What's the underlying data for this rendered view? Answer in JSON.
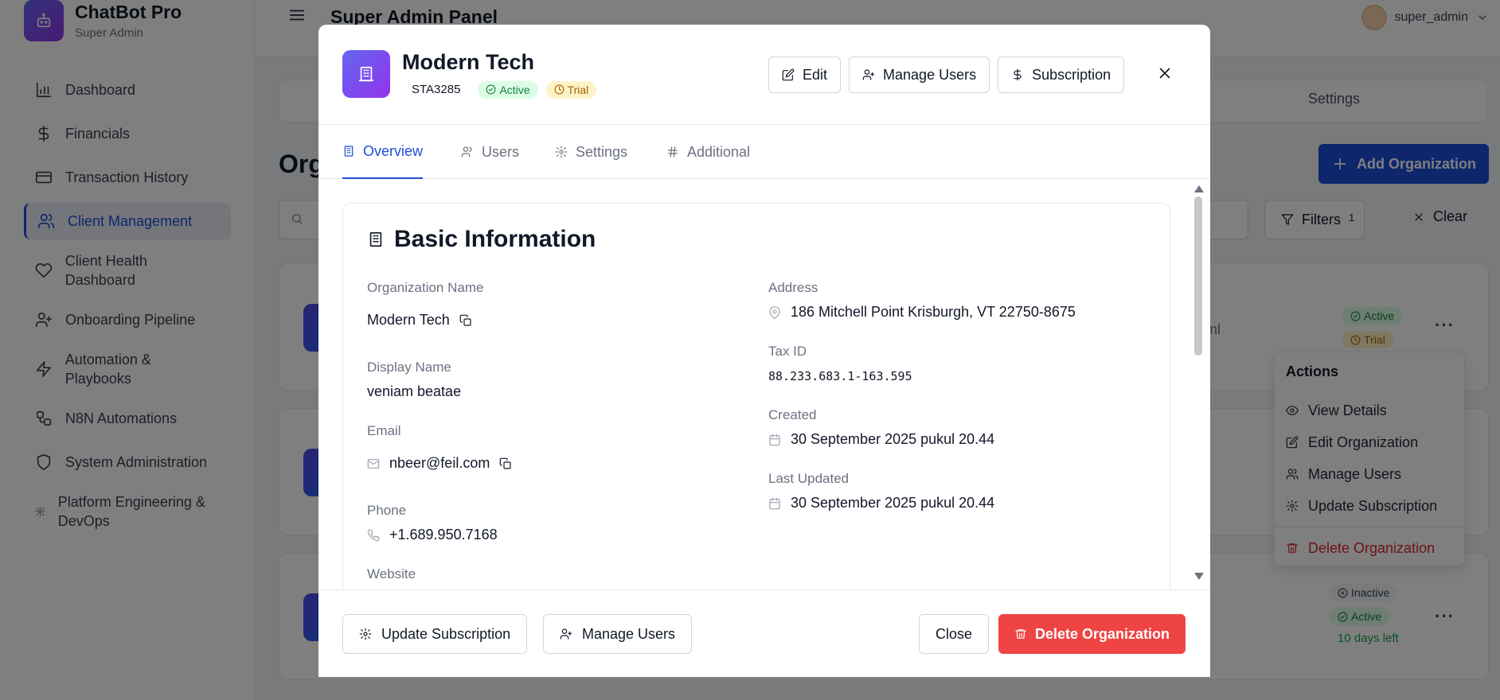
{
  "brand": {
    "title": "ChatBot Pro",
    "subtitle": "Super Admin"
  },
  "sidebar": {
    "items": [
      {
        "label": "Dashboard",
        "icon": "bar-chart-icon"
      },
      {
        "label": "Financials",
        "icon": "dollar-icon"
      },
      {
        "label": "Transaction History",
        "icon": "credit-card-icon"
      },
      {
        "label": "Client Management",
        "icon": "users-icon",
        "active": true
      },
      {
        "label": "Client Health Dashboard",
        "icon": "heart-icon"
      },
      {
        "label": "Onboarding Pipeline",
        "icon": "user-plus-icon"
      },
      {
        "label": "Automation & Playbooks",
        "icon": "zap-icon"
      },
      {
        "label": "N8N Automations",
        "icon": "workflow-icon"
      },
      {
        "label": "System Administration",
        "icon": "shield-icon"
      },
      {
        "label": "Platform Engineering & DevOps",
        "icon": "cog-icon"
      }
    ]
  },
  "header": {
    "title": "Super Admin Panel",
    "username": "super_admin"
  },
  "page": {
    "settings_tab": "Settings",
    "heading": "Org",
    "add_button": "Add Organization",
    "filters_label": "Filters",
    "filters_count": "1",
    "clear_label": "Clear"
  },
  "cards": [
    {
      "badges": [
        "Active",
        "Trial"
      ],
      "partial_text": "ml"
    },
    {
      "badges": []
    },
    {
      "badges": [
        "Inactive",
        "Active"
      ],
      "days_left": "10 days left"
    }
  ],
  "actions_menu": {
    "title": "Actions",
    "items": [
      "View Details",
      "Edit Organization",
      "Manage Users",
      "Update Subscription"
    ],
    "danger_item": "Delete Organization"
  },
  "modal": {
    "title": "Modern Tech",
    "code": "STA3285",
    "status_badge": "Active",
    "plan_badge": "Trial",
    "edit_label": "Edit",
    "manage_users_label": "Manage Users",
    "subscription_label": "Subscription",
    "tabs": [
      "Overview",
      "Users",
      "Settings",
      "Additional"
    ],
    "section_title": "Basic Information",
    "fields": {
      "org_name_label": "Organization Name",
      "org_name": "Modern Tech",
      "display_name_label": "Display Name",
      "display_name": "veniam beatae",
      "email_label": "Email",
      "email": "nbeer@feil.com",
      "phone_label": "Phone",
      "phone": "+1.689.950.7168",
      "website_label": "Website",
      "address_label": "Address",
      "address": "186 Mitchell Point Krisburgh, VT 22750-8675",
      "tax_label": "Tax ID",
      "tax": "88.233.683.1-163.595",
      "created_label": "Created",
      "created": "30 September 2025 pukul 20.44",
      "updated_label": "Last Updated",
      "updated": "30 September 2025 pukul 20.44"
    },
    "footer": {
      "update_subscription": "Update Subscription",
      "manage_users": "Manage Users",
      "close": "Close",
      "delete": "Delete Organization"
    }
  },
  "colors": {
    "primary": "#1d4ed8",
    "danger": "#ef4444",
    "success": "#15803d",
    "warning": "#a16207"
  }
}
